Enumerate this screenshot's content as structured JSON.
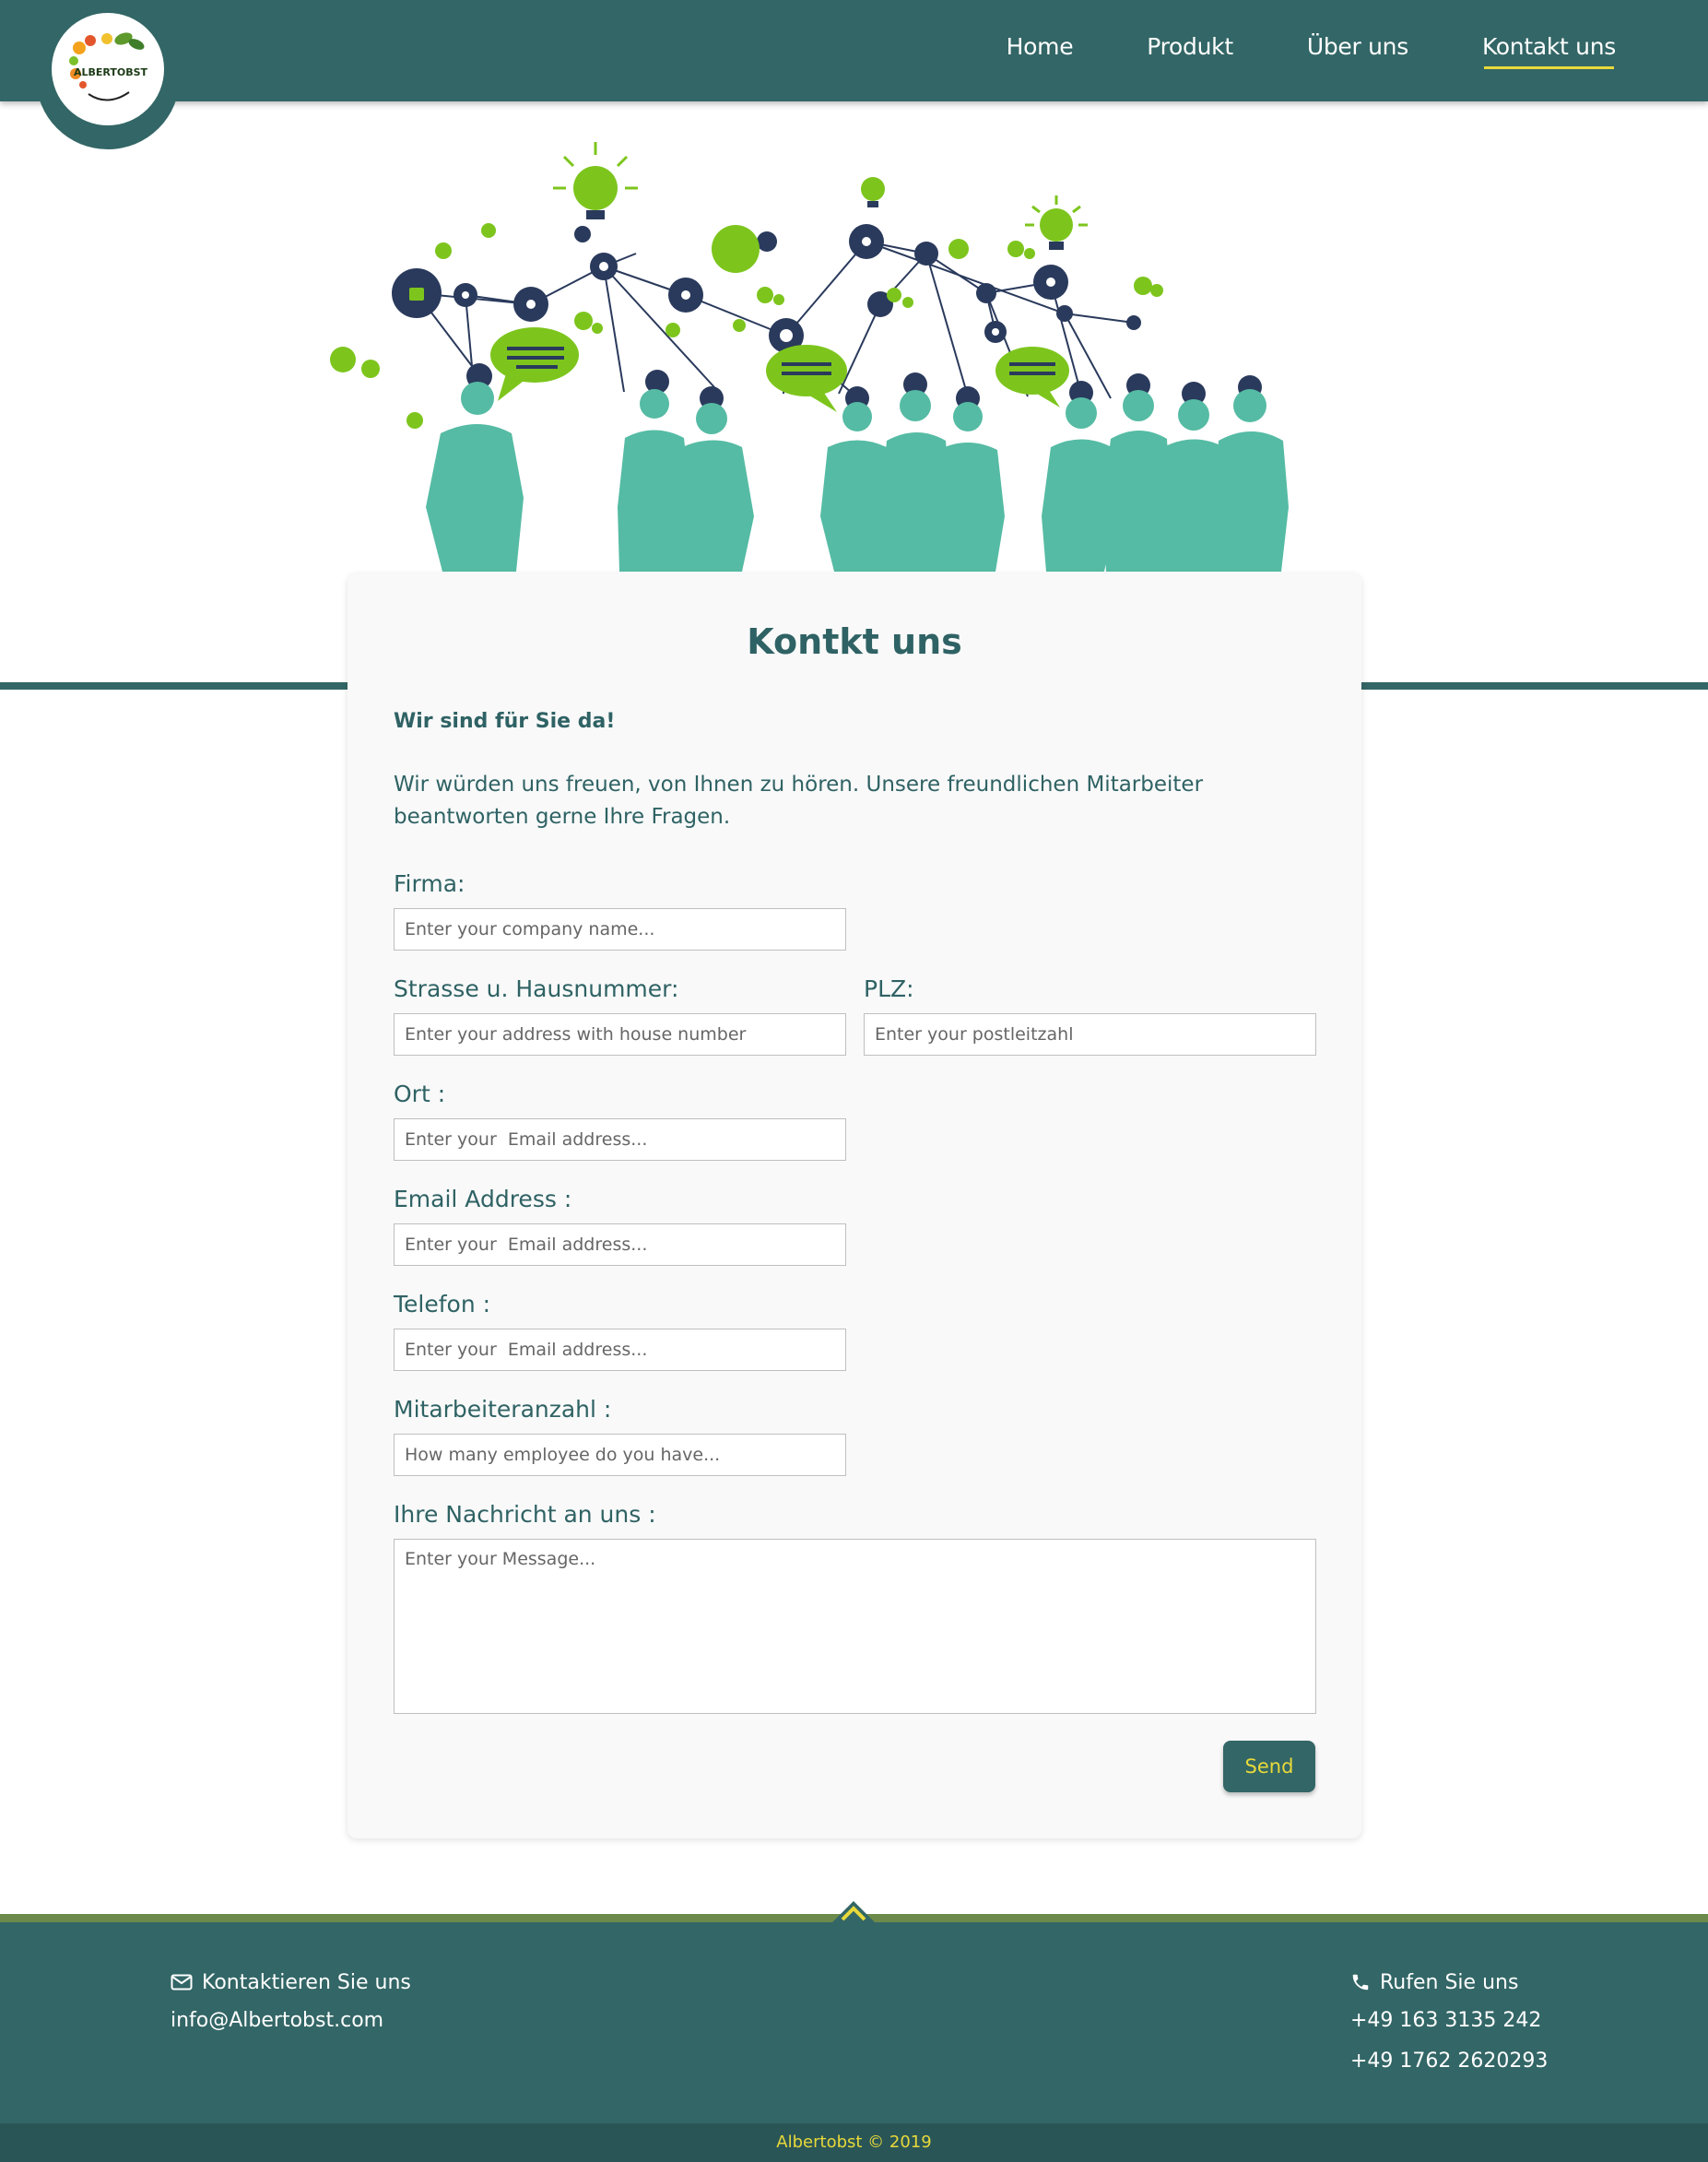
{
  "logo": {
    "text": "ALBERTOBST"
  },
  "nav": {
    "items": [
      {
        "label": "Home",
        "active": false
      },
      {
        "label": "Produkt",
        "active": false
      },
      {
        "label": "Über uns",
        "active": false
      },
      {
        "label": "Kontakt uns",
        "active": true
      }
    ]
  },
  "colors": {
    "primary": "#336666",
    "accent": "#e8d93a",
    "hero_people": "#55bba4",
    "hero_green": "#7dc51d",
    "hero_nodes": "#2a3a5c"
  },
  "contact": {
    "title": "Kontkt uns",
    "intro_bold": "Wir sind für Sie da!",
    "intro_text": "Wir würden uns freuen, von Ihnen zu hören. Unsere freundlichen Mitarbeiter beantworten gerne Ihre Fragen.",
    "fields": {
      "firma": {
        "label": "Firma:",
        "placeholder": "Enter your company name..."
      },
      "strasse": {
        "label": "Strasse u. Hausnummer:",
        "placeholder": "Enter your address with house number"
      },
      "plz": {
        "label": "PLZ:",
        "placeholder": "Enter your postleitzahl"
      },
      "ort": {
        "label": "Ort :",
        "placeholder": "Enter your  Email address..."
      },
      "email": {
        "label": "Email Address :",
        "placeholder": "Enter your  Email address..."
      },
      "telefon": {
        "label": "Telefon :",
        "placeholder": "Enter your  Email address..."
      },
      "mitarbeiter": {
        "label": "Mitarbeiteranzahl :",
        "placeholder": "How many employee do you have..."
      },
      "nachricht": {
        "label": "Ihre Nachricht an uns :",
        "placeholder": "Enter your Message..."
      }
    },
    "send_label": "Send"
  },
  "footer": {
    "left_heading": "Kontaktieren Sie uns",
    "email": "info@Albertobst.com",
    "right_heading": "Rufen Sie uns",
    "phones": [
      "+49 163 3135 242",
      "+49 1762 2620293"
    ],
    "copyright": "Albertobst © 2019"
  }
}
